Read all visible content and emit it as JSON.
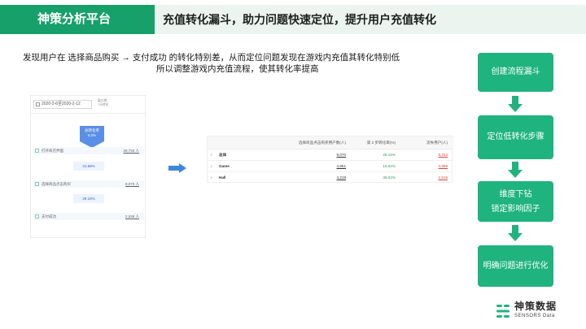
{
  "header": {
    "brand": "神策分析平台",
    "title": "充值转化漏斗，助力问题快速定位，提升用户充值转化"
  },
  "description": {
    "line1": "发现用户在 选择商品购买 → 支付成功 的转化特别差，从而定位问题发现在游戏内充值其转化特别低",
    "line2": "所以调整游戏内充值流程，使其转化率提高"
  },
  "funnel": {
    "date_range": "2020-2-6至2020-2-12",
    "side_text": [
      "窗口期",
      "7天转化"
    ],
    "overall_label": "总转化率",
    "overall_rate": "6.0%",
    "steps": [
      {
        "name": "打开商店界面",
        "value": "28,725 人"
      },
      {
        "name": "选择商品点击购买",
        "value": "9,070 人"
      },
      {
        "name": "支付成功",
        "value": "2,538 人"
      }
    ],
    "rates": [
      "31.58%",
      "28.16%"
    ]
  },
  "table": {
    "columns": [
      "",
      "选择商品点击购买用户数(人)",
      "第 2 步转化率(%)",
      "流失用户(人)"
    ],
    "rows": [
      {
        "name": "总体",
        "users": "9,070",
        "rate": "28.16%",
        "lost": "6,314"
      },
      {
        "name": "Game",
        "users": "4,851",
        "rate": "19.62%",
        "lost": "3,899"
      },
      {
        "name": "Hall",
        "users": "4,219",
        "rate": "38.02%",
        "lost": "2,615"
      }
    ]
  },
  "flow": {
    "steps": [
      "创建流程漏斗",
      "定位低转化步骤",
      "维度下钻",
      "锁定影响因子",
      "明确问题进行优化"
    ]
  },
  "logo": {
    "name_cn": "神策数据",
    "name_en": "SENSORS Data"
  },
  "colors": {
    "brand_green": "#17a06a",
    "flow_green": "#1fb37f",
    "funnel_blue": "#5a8fe8",
    "positive": "#2e9b5e",
    "negative": "#e0433a"
  }
}
